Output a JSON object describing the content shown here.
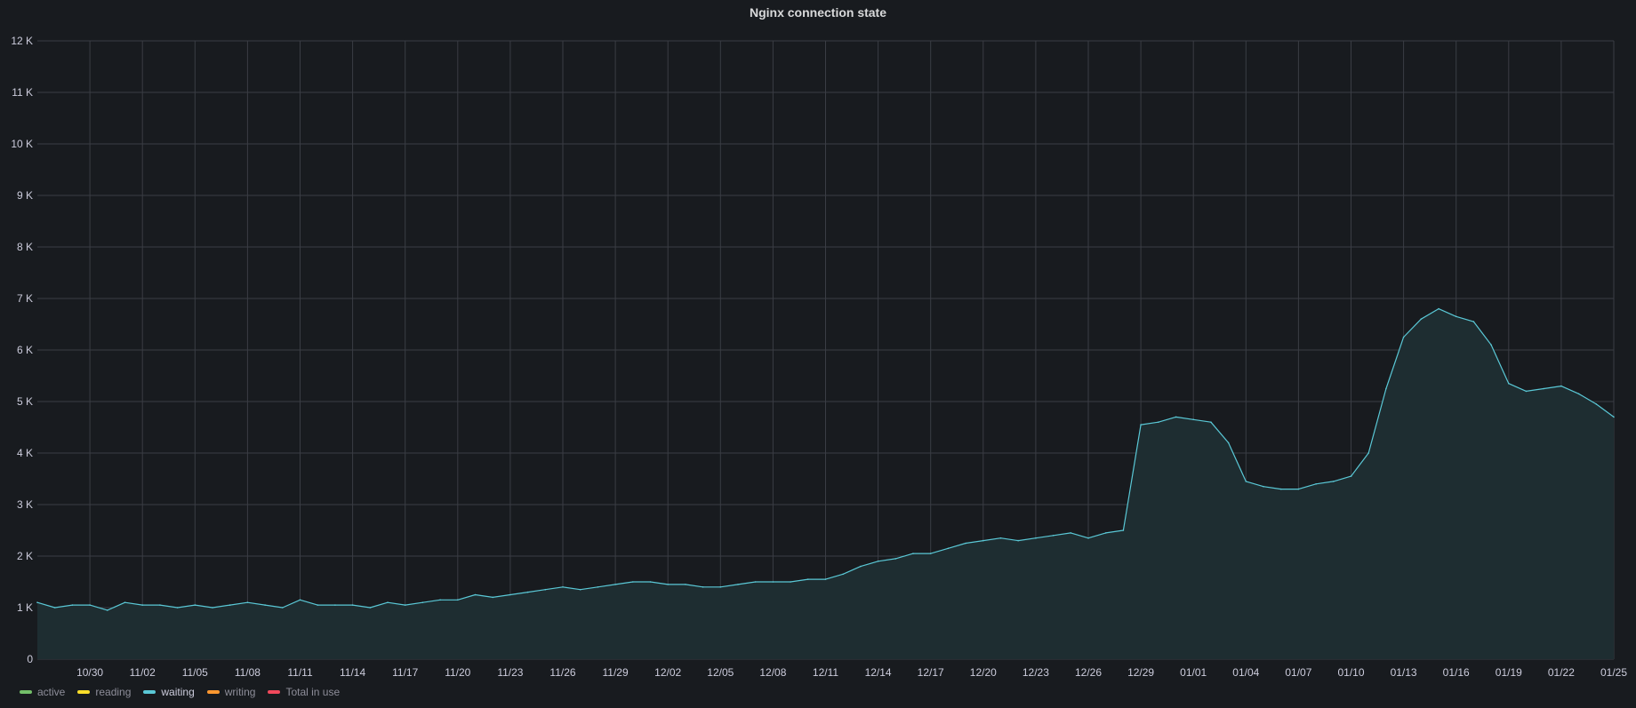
{
  "title": "Nginx connection state",
  "colors": {
    "background": "#181b1f",
    "grid": "#3a3d44",
    "text": "#ccccdc",
    "waiting_line": "#5ac8d6",
    "waiting_fill": "#1e2d31"
  },
  "chart_data": {
    "type": "area",
    "title": "Nginx connection state",
    "ylim": [
      0,
      12000
    ],
    "yticks": [
      {
        "value": 0,
        "label": "0"
      },
      {
        "value": 1000,
        "label": "1 K"
      },
      {
        "value": 2000,
        "label": "2 K"
      },
      {
        "value": 3000,
        "label": "3 K"
      },
      {
        "value": 4000,
        "label": "4 K"
      },
      {
        "value": 5000,
        "label": "5 K"
      },
      {
        "value": 6000,
        "label": "6 K"
      },
      {
        "value": 7000,
        "label": "7 K"
      },
      {
        "value": 8000,
        "label": "8 K"
      },
      {
        "value": 9000,
        "label": "9 K"
      },
      {
        "value": 10000,
        "label": "10 K"
      },
      {
        "value": 11000,
        "label": "11 K"
      },
      {
        "value": 12000,
        "label": "12 K"
      }
    ],
    "x_start": "10/27",
    "x_end": "01/25",
    "xtick_labels": [
      "10/30",
      "11/02",
      "11/05",
      "11/08",
      "11/11",
      "11/14",
      "11/17",
      "11/20",
      "11/23",
      "11/26",
      "11/29",
      "12/02",
      "12/05",
      "12/08",
      "12/11",
      "12/14",
      "12/17",
      "12/20",
      "12/23",
      "12/26",
      "12/29",
      "01/01",
      "01/04",
      "01/07",
      "01/10",
      "01/13",
      "01/16",
      "01/19",
      "01/22",
      "01/25"
    ],
    "grid": true,
    "legend_placement": "bottom-left",
    "legend": [
      {
        "name": "active",
        "color": "#73bf69"
      },
      {
        "name": "reading",
        "color": "#fade2a"
      },
      {
        "name": "waiting",
        "color": "#5ac8d6"
      },
      {
        "name": "writing",
        "color": "#ff9830"
      },
      {
        "name": "Total in use",
        "color": "#f2495c"
      }
    ],
    "series": [
      {
        "name": "waiting",
        "color": "#5ac8d6",
        "x": [
          "10/27",
          "10/28",
          "10/29",
          "10/30",
          "10/31",
          "11/01",
          "11/02",
          "11/03",
          "11/04",
          "11/05",
          "11/06",
          "11/07",
          "11/08",
          "11/09",
          "11/10",
          "11/11",
          "11/12",
          "11/13",
          "11/14",
          "11/15",
          "11/16",
          "11/17",
          "11/18",
          "11/19",
          "11/20",
          "11/21",
          "11/22",
          "11/23",
          "11/24",
          "11/25",
          "11/26",
          "11/27",
          "11/28",
          "11/29",
          "11/30",
          "12/01",
          "12/02",
          "12/03",
          "12/04",
          "12/05",
          "12/06",
          "12/07",
          "12/08",
          "12/09",
          "12/10",
          "12/11",
          "12/12",
          "12/13",
          "12/14",
          "12/15",
          "12/16",
          "12/17",
          "12/18",
          "12/19",
          "12/20",
          "12/21",
          "12/22",
          "12/23",
          "12/24",
          "12/25",
          "12/26",
          "12/27",
          "12/28",
          "12/29",
          "12/30",
          "12/31",
          "01/01",
          "01/02",
          "01/03",
          "01/04",
          "01/05",
          "01/06",
          "01/07",
          "01/08",
          "01/09",
          "01/10",
          "01/11",
          "01/12",
          "01/13",
          "01/14",
          "01/15",
          "01/16",
          "01/17",
          "01/18",
          "01/19",
          "01/20",
          "01/21",
          "01/22",
          "01/23",
          "01/24",
          "01/25"
        ],
        "values": [
          1100,
          1000,
          1050,
          1050,
          950,
          1100,
          1050,
          1050,
          1000,
          1050,
          1000,
          1050,
          1100,
          1050,
          1000,
          1150,
          1050,
          1050,
          1050,
          1000,
          1100,
          1050,
          1100,
          1150,
          1150,
          1250,
          1200,
          1250,
          1300,
          1350,
          1400,
          1350,
          1400,
          1450,
          1500,
          1500,
          1450,
          1450,
          1400,
          1400,
          1450,
          1500,
          1500,
          1500,
          1550,
          1550,
          1650,
          1800,
          1900,
          1950,
          2050,
          2050,
          2150,
          2250,
          2300,
          2350,
          2300,
          2350,
          2400,
          2450,
          2350,
          2450,
          2500,
          4550,
          4600,
          4700,
          4650,
          4600,
          4200,
          3450,
          3350,
          3300,
          3300,
          3400,
          3450,
          3550,
          4000,
          5250,
          6250,
          6600,
          6800,
          6650,
          6550,
          6100,
          5350,
          5200,
          5250,
          5300,
          5150,
          4950,
          4700
        ]
      }
    ]
  }
}
